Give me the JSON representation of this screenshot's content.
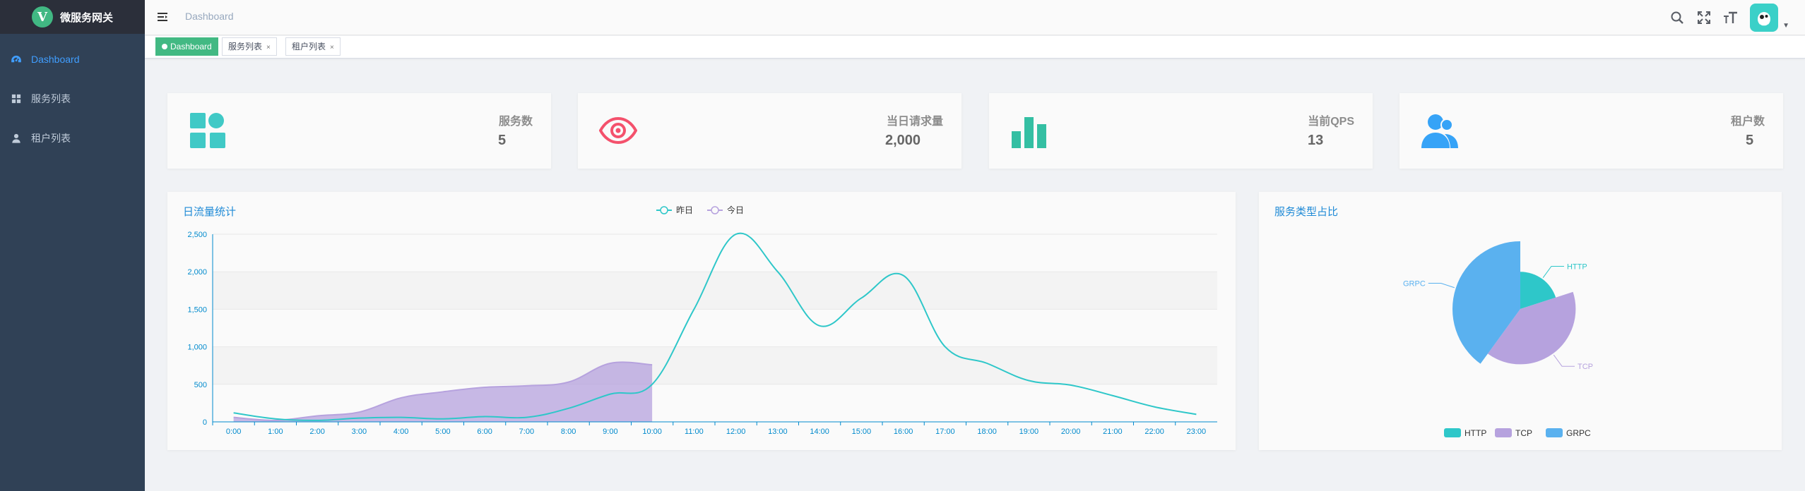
{
  "app": {
    "title": "微服务网关",
    "logo_letter": "V"
  },
  "sidebar": {
    "items": [
      {
        "label": "Dashboard",
        "icon": "dashboard-icon",
        "active": true
      },
      {
        "label": "服务列表",
        "icon": "grid-icon",
        "active": false
      },
      {
        "label": "租户列表",
        "icon": "user-icon",
        "active": false
      }
    ]
  },
  "navbar": {
    "breadcrumb": "Dashboard",
    "icons": [
      "search-icon",
      "fullscreen-icon",
      "font-size-icon"
    ]
  },
  "tags": [
    {
      "label": "Dashboard",
      "active": true
    },
    {
      "label": "服务列表",
      "active": false
    },
    {
      "label": "租户列表",
      "active": false
    }
  ],
  "panels": [
    {
      "label": "服务数",
      "value": "5",
      "icon": "apps-icon",
      "color": "#40c9c6"
    },
    {
      "label": "当日请求量",
      "value": "2,000",
      "icon": "eye-icon",
      "color": "#f4516c"
    },
    {
      "label": "当前QPS",
      "value": "13",
      "icon": "bar-chart-icon",
      "color": "#34bfa3"
    },
    {
      "label": "租户数",
      "value": "5",
      "icon": "people-icon",
      "color": "#36a3f7"
    }
  ],
  "colors": {
    "teal": "#2ec7c9",
    "purple": "#b6a2de",
    "blue": "#5ab1ef",
    "accent": "#409eff",
    "sidebar": "#304156"
  },
  "chart_data": [
    {
      "type": "line",
      "title": "日流量统计",
      "legend": [
        "昨日",
        "今日"
      ],
      "legend_position": "top-center",
      "x": [
        "0:00",
        "1:00",
        "2:00",
        "3:00",
        "4:00",
        "5:00",
        "6:00",
        "7:00",
        "8:00",
        "9:00",
        "10:00",
        "11:00",
        "12:00",
        "13:00",
        "14:00",
        "15:00",
        "16:00",
        "17:00",
        "18:00",
        "19:00",
        "20:00",
        "21:00",
        "22:00",
        "23:00"
      ],
      "ylim": [
        0,
        2500
      ],
      "yticks": [
        "0",
        "500",
        "1,000",
        "1,500",
        "2,000",
        "2,500"
      ],
      "grid": true,
      "series": [
        {
          "name": "昨日",
          "color": "#2ec7c9",
          "area": false,
          "values": [
            120,
            40,
            20,
            50,
            60,
            40,
            70,
            60,
            180,
            370,
            500,
            1500,
            2500,
            2000,
            1280,
            1650,
            1950,
            1000,
            780,
            550,
            490,
            350,
            200,
            100
          ]
        },
        {
          "name": "今日",
          "color": "#b6a2de",
          "area": true,
          "values": [
            60,
            20,
            80,
            130,
            320,
            400,
            460,
            480,
            530,
            780,
            760
          ]
        }
      ]
    },
    {
      "type": "pie",
      "title": "服务类型占比",
      "legend": [
        "HTTP",
        "TCP",
        "GRPC"
      ],
      "legend_position": "bottom-center",
      "slices": [
        {
          "name": "HTTP",
          "value": 1,
          "color": "#2ec7c9"
        },
        {
          "name": "TCP",
          "value": 2,
          "color": "#b6a2de"
        },
        {
          "name": "GRPC",
          "value": 2,
          "color": "#5ab1ef"
        }
      ]
    }
  ]
}
